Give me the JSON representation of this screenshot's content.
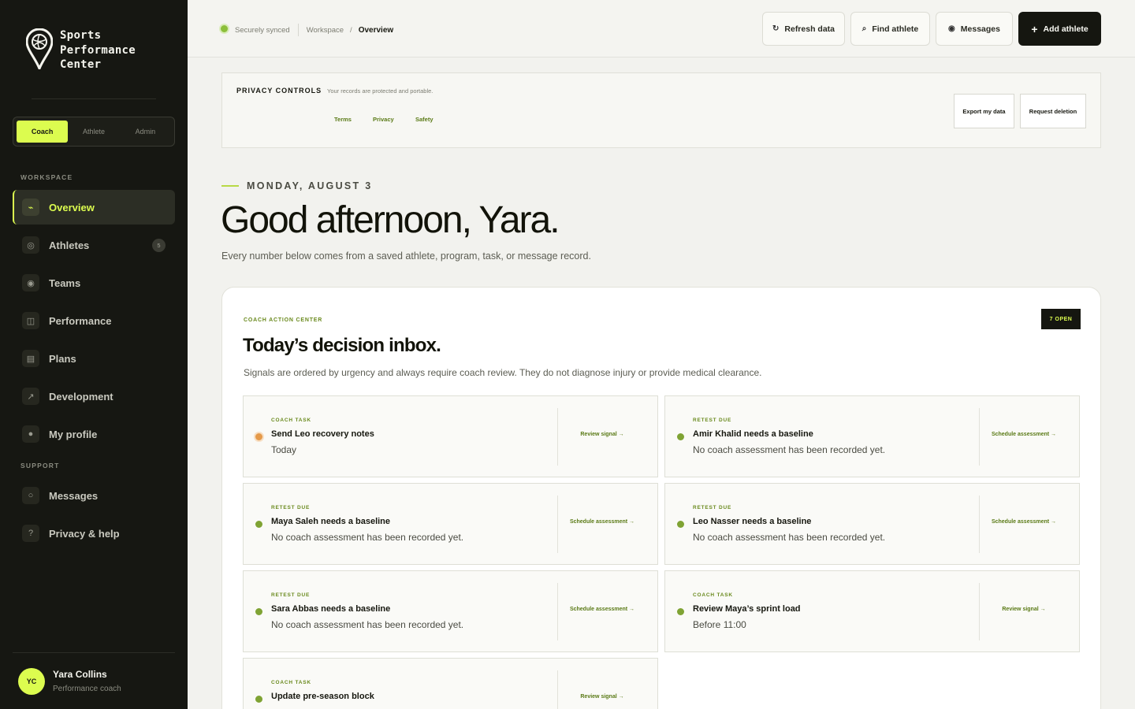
{
  "brand": {
    "line1": "Sports",
    "line2": "Performance",
    "line3": "Center"
  },
  "roles": [
    {
      "label": "Coach",
      "active": true
    },
    {
      "label": "Athlete",
      "active": false
    },
    {
      "label": "Admin",
      "active": false
    }
  ],
  "sidebar": {
    "workspace_label": "WORKSPACE",
    "support_label": "SUPPORT",
    "items": [
      {
        "label": "Overview",
        "icon": "pulse-icon",
        "active": true
      },
      {
        "label": "Athletes",
        "icon": "ring-icon",
        "badge": "5"
      },
      {
        "label": "Teams",
        "icon": "target-icon"
      },
      {
        "label": "Performance",
        "icon": "columns-icon"
      },
      {
        "label": "Plans",
        "icon": "list-icon"
      },
      {
        "label": "Development",
        "icon": "trend-arrow-icon"
      },
      {
        "label": "My profile",
        "icon": "dot-icon"
      }
    ],
    "support_items": [
      {
        "label": "Messages",
        "icon": "circle-icon"
      },
      {
        "label": "Privacy & help",
        "icon": "question-icon"
      }
    ]
  },
  "user": {
    "initials": "YC",
    "name": "Yara Collins",
    "role": "Performance coach"
  },
  "topbar": {
    "sync_status": "Securely synced",
    "breadcrumb_parent": "Workspace",
    "breadcrumb_sep": "/",
    "breadcrumb_current": "Overview",
    "buttons": {
      "refresh": "Refresh data",
      "find": "Find athlete",
      "messages": "Messages",
      "add": "Add athlete"
    }
  },
  "privacy": {
    "title": "PRIVACY CONTROLS",
    "subtitle": "Your records are protected and portable.",
    "links": [
      "Terms",
      "Privacy",
      "Safety"
    ],
    "export_label": "Export my data",
    "delete_label": "Request deletion"
  },
  "greeting": {
    "date": "MONDAY, AUGUST 3",
    "title": "Good afternoon, Yara.",
    "subtitle": "Every number below comes from a saved athlete, program, task, or message record."
  },
  "action_center": {
    "eyebrow": "COACH ACTION CENTER",
    "title": "Today’s decision inbox.",
    "subtitle": "Signals are ordered by urgency and always require coach review. They do not diagnose injury or provide medical clearance.",
    "open_badge": "7 OPEN",
    "signals": [
      {
        "kind": "COACH TASK",
        "title": "Send Leo recovery notes",
        "detail": "Today",
        "action": "Review signal →",
        "status": "warning"
      },
      {
        "kind": "RETEST DUE",
        "title": "Amir Khalid needs a baseline",
        "detail": "No coach assessment has been recorded yet.",
        "action": "Schedule assessment →",
        "status": "ok"
      },
      {
        "kind": "RETEST DUE",
        "title": "Maya Saleh needs a baseline",
        "detail": "No coach assessment has been recorded yet.",
        "action": "Schedule assessment →",
        "status": "ok"
      },
      {
        "kind": "RETEST DUE",
        "title": "Leo Nasser needs a baseline",
        "detail": "No coach assessment has been recorded yet.",
        "action": "Schedule assessment →",
        "status": "ok"
      },
      {
        "kind": "RETEST DUE",
        "title": "Sara Abbas needs a baseline",
        "detail": "No coach assessment has been recorded yet.",
        "action": "Schedule assessment →",
        "status": "ok"
      },
      {
        "kind": "COACH TASK",
        "title": "Review Maya’s sprint load",
        "detail": "Before 11:00",
        "action": "Review signal →",
        "status": "ok"
      },
      {
        "kind": "COACH TASK",
        "title": "Update pre-season block",
        "detail": "",
        "action": "Review signal →",
        "status": "ok"
      }
    ]
  },
  "colors": {
    "accent": "#dcfc4f",
    "sidebar_bg": "#161712",
    "ok_dot": "#7fa334",
    "warn_dot": "#e59a4a",
    "link": "#5a7a16"
  }
}
